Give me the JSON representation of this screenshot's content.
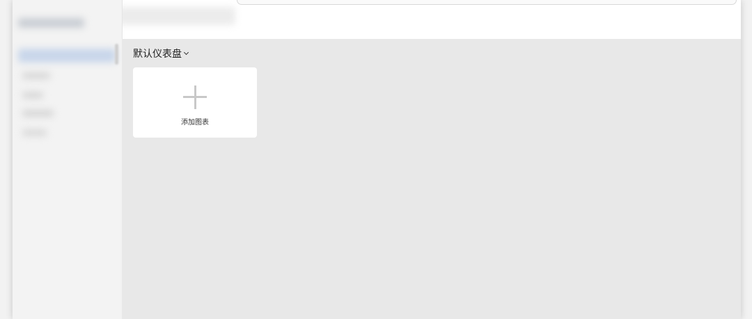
{
  "dashboard": {
    "title": "默认仪表盘",
    "add_chart_label": "添加图表"
  },
  "icons": {
    "dropdown": "chevron-down-icon",
    "add": "plus-icon"
  },
  "colors": {
    "main_background": "#e8e8e8",
    "card_background": "#ffffff",
    "plus_color": "#c8c8c8"
  }
}
